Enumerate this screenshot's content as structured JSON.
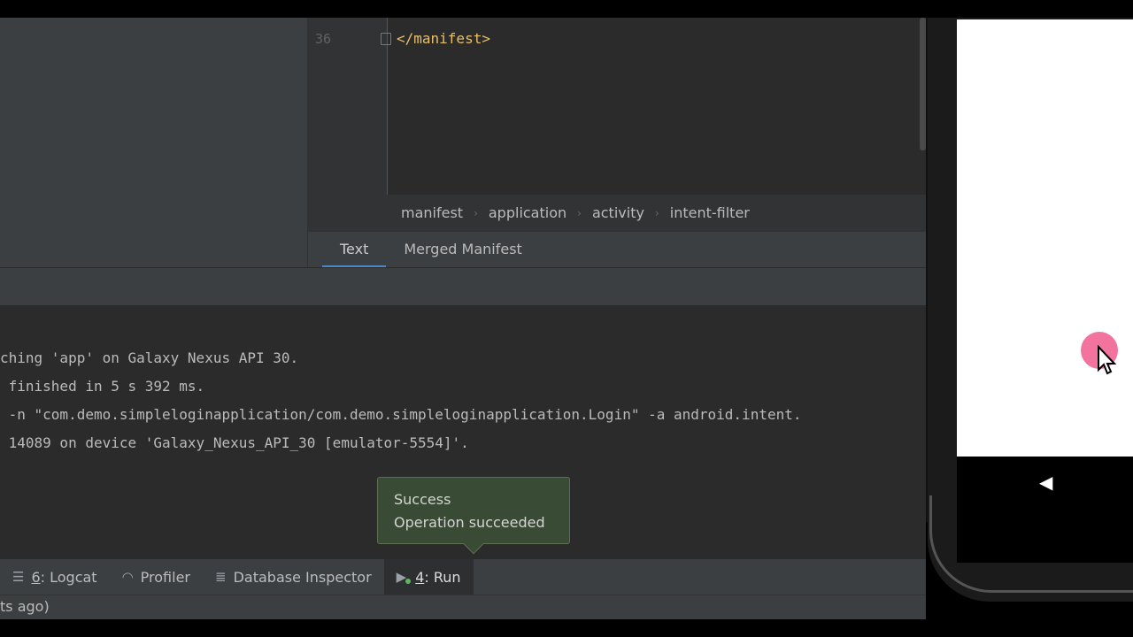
{
  "editor": {
    "line_number": "36",
    "code_line": "</manifest>"
  },
  "breadcrumb": {
    "items": [
      "manifest",
      "application",
      "activity",
      "intent-filter"
    ]
  },
  "editor_tabs": [
    {
      "label": "Text"
    },
    {
      "label": "Merged Manifest"
    }
  ],
  "console": {
    "lines": [
      "ching 'app' on Galaxy Nexus API 30.",
      " finished in 5 s 392 ms.",
      " -n \"com.demo.simpleloginapplication/com.demo.simpleloginapplication.Login\" -a android.intent.",
      " 14089 on device 'Galaxy_Nexus_API_30 [emulator-5554]'."
    ]
  },
  "notification": {
    "title": "Success",
    "message": "Operation succeeded"
  },
  "tool_windows": {
    "logcat_number": "6",
    "logcat_label": ": Logcat",
    "profiler_label": "Profiler",
    "database_label": "Database Inspector",
    "run_number": "4",
    "run_label": ": Run"
  },
  "status_bar": {
    "text": "ts ago)"
  },
  "icons": {
    "logcat": "logcat-icon",
    "profiler": "profiler-gauge-icon",
    "database": "database-icon",
    "run": "run-play-icon",
    "back": "back-triangle-icon",
    "cursor": "mouse-pointer-icon"
  },
  "colors": {
    "ide_background": "#2b2b2b",
    "panel": "#3c3f41",
    "code_tag": "#e8bf6a",
    "active_tab_underline": "#4a88c7",
    "toast_background": "#394a35",
    "touch_indicator": "#f05a8c"
  }
}
